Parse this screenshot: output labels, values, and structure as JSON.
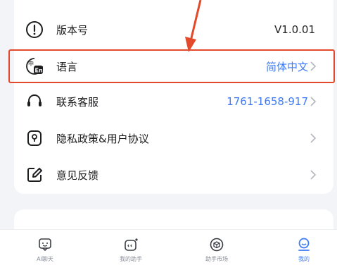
{
  "settings": {
    "items": [
      {
        "label": "版本号",
        "value": "V1.0.01",
        "icon": "info-circle-icon",
        "chevron": false
      },
      {
        "label": "语言",
        "value": "简体中文",
        "icon": "language-icon",
        "chevron": true
      },
      {
        "label": "联系客服",
        "value": "1761-1658-917",
        "icon": "headset-icon",
        "chevron": true
      },
      {
        "label": "隐私政策&用户协议",
        "value": "",
        "icon": "privacy-shield-icon",
        "chevron": true
      },
      {
        "label": "意见反馈",
        "value": "",
        "icon": "feedback-edit-icon",
        "chevron": true
      }
    ]
  },
  "tabbar": {
    "tabs": [
      {
        "label": "AI聊天",
        "icon": "chat-bubble-icon"
      },
      {
        "label": "我的助手",
        "icon": "assistant-icon"
      },
      {
        "label": "助手市场",
        "icon": "market-cube-icon"
      },
      {
        "label": "我的",
        "icon": "profile-icon"
      }
    ],
    "active_index": 3
  },
  "colors": {
    "accent": "#3f7bf6",
    "annotation": "#e34a2b",
    "background": "#f2f4f7"
  }
}
